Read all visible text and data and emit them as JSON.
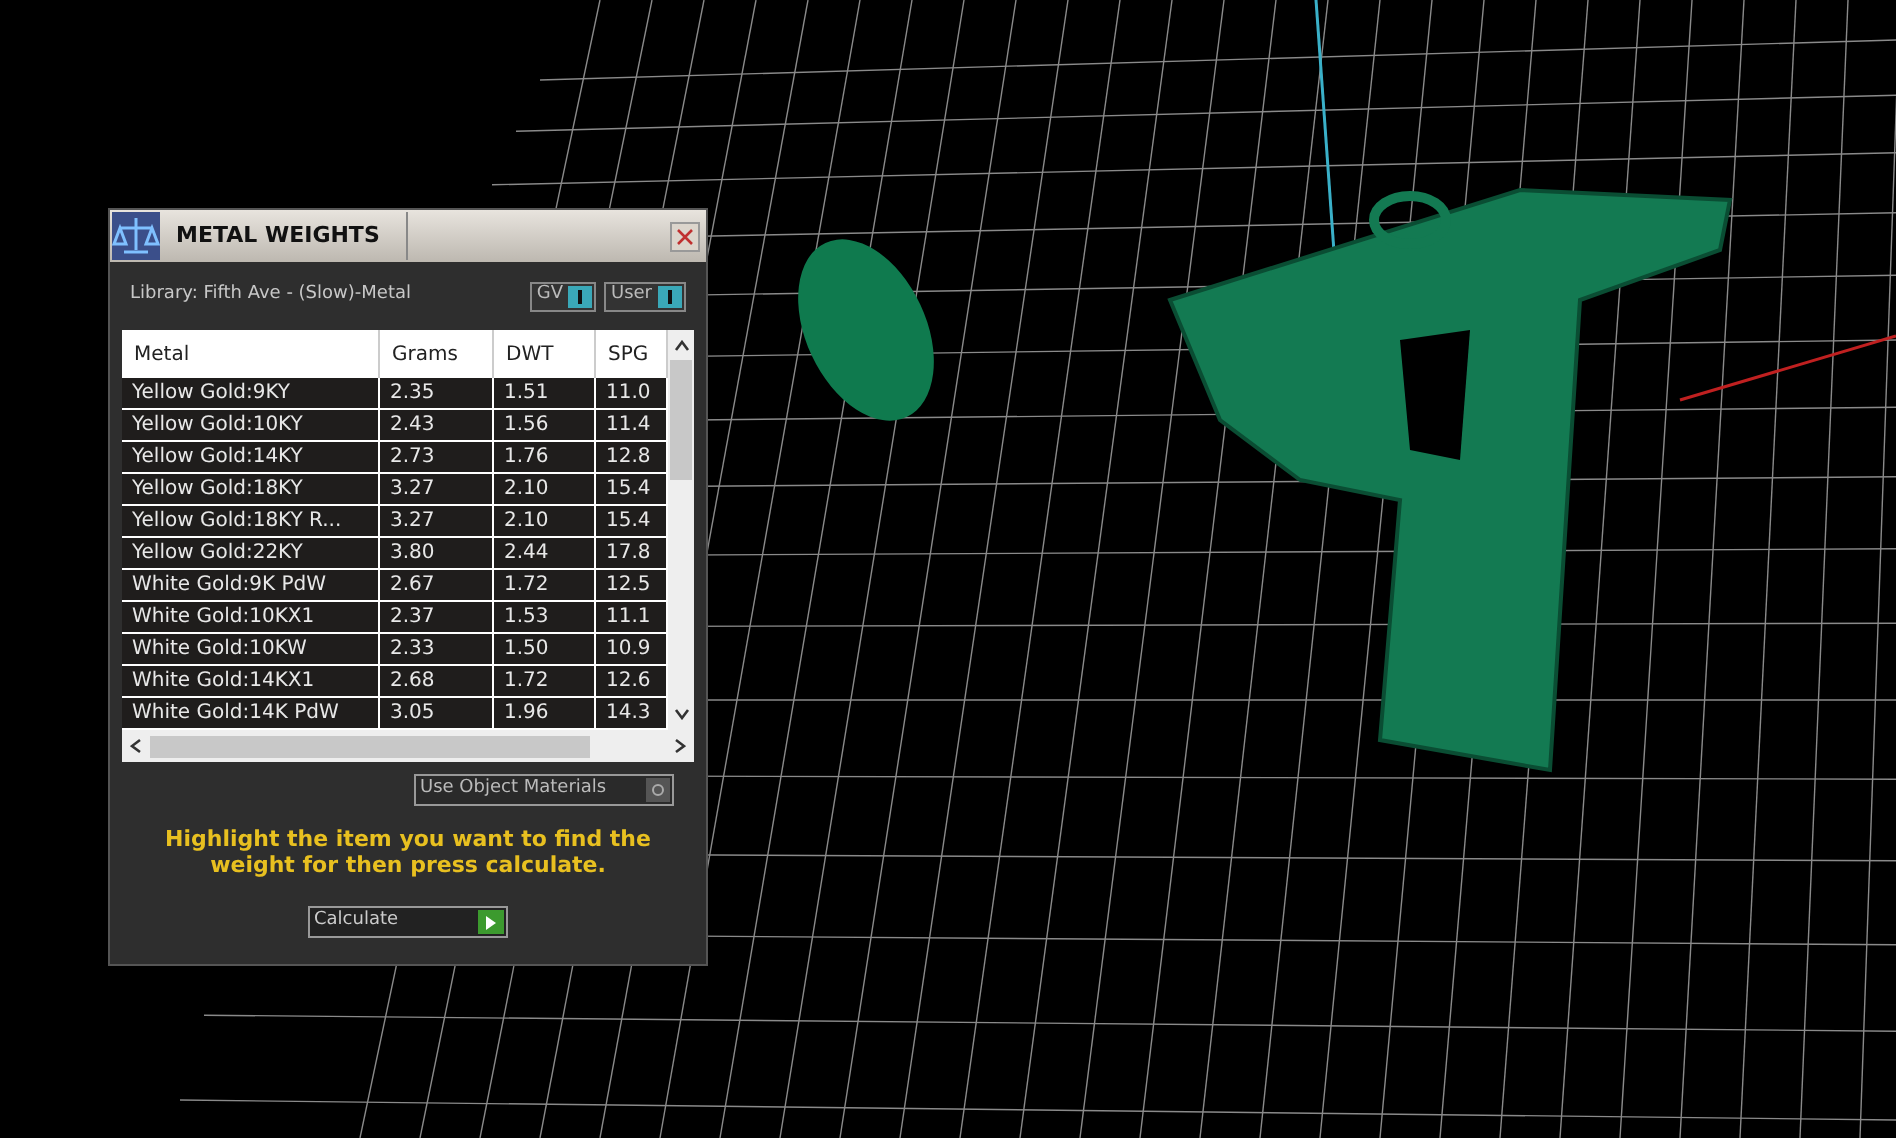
{
  "panel": {
    "title": "METAL WEIGHTS",
    "library": "Library: Fifth Ave - (Slow)-Metal",
    "toggles": [
      {
        "label": "GV",
        "on": true
      },
      {
        "label": "User",
        "on": true
      }
    ],
    "table": {
      "columns": [
        "Metal",
        "Grams",
        "DWT",
        "SPG"
      ],
      "rows": [
        {
          "cells": [
            "Yellow Gold:9KY",
            "2.35",
            "1.51",
            "11.0"
          ]
        },
        {
          "cells": [
            "Yellow Gold:10KY",
            "2.43",
            "1.56",
            "11.4"
          ]
        },
        {
          "cells": [
            "Yellow Gold:14KY",
            "2.73",
            "1.76",
            "12.8"
          ]
        },
        {
          "cells": [
            "Yellow Gold:18KY",
            "3.27",
            "2.10",
            "15.4"
          ]
        },
        {
          "cells": [
            "Yellow Gold:18KY R...",
            "3.27",
            "2.10",
            "15.4"
          ]
        },
        {
          "cells": [
            "Yellow Gold:22KY",
            "3.80",
            "2.44",
            "17.8"
          ]
        },
        {
          "cells": [
            "White Gold:9K PdW",
            "2.67",
            "1.72",
            "12.5"
          ]
        },
        {
          "cells": [
            "White Gold:10KX1",
            "2.37",
            "1.53",
            "11.1"
          ]
        },
        {
          "cells": [
            "White Gold:10KW",
            "2.33",
            "1.50",
            "10.9"
          ]
        },
        {
          "cells": [
            "White Gold:14KX1",
            "2.68",
            "1.72",
            "12.6"
          ]
        },
        {
          "cells": [
            "White Gold:14K PdW",
            "3.05",
            "1.96",
            "14.3"
          ]
        }
      ]
    },
    "use_object_materials": {
      "label": "Use Object Materials",
      "checked": false
    },
    "hint": "Highlight the item you want to find the weight for then press calculate.",
    "calculate": "Calculate"
  }
}
